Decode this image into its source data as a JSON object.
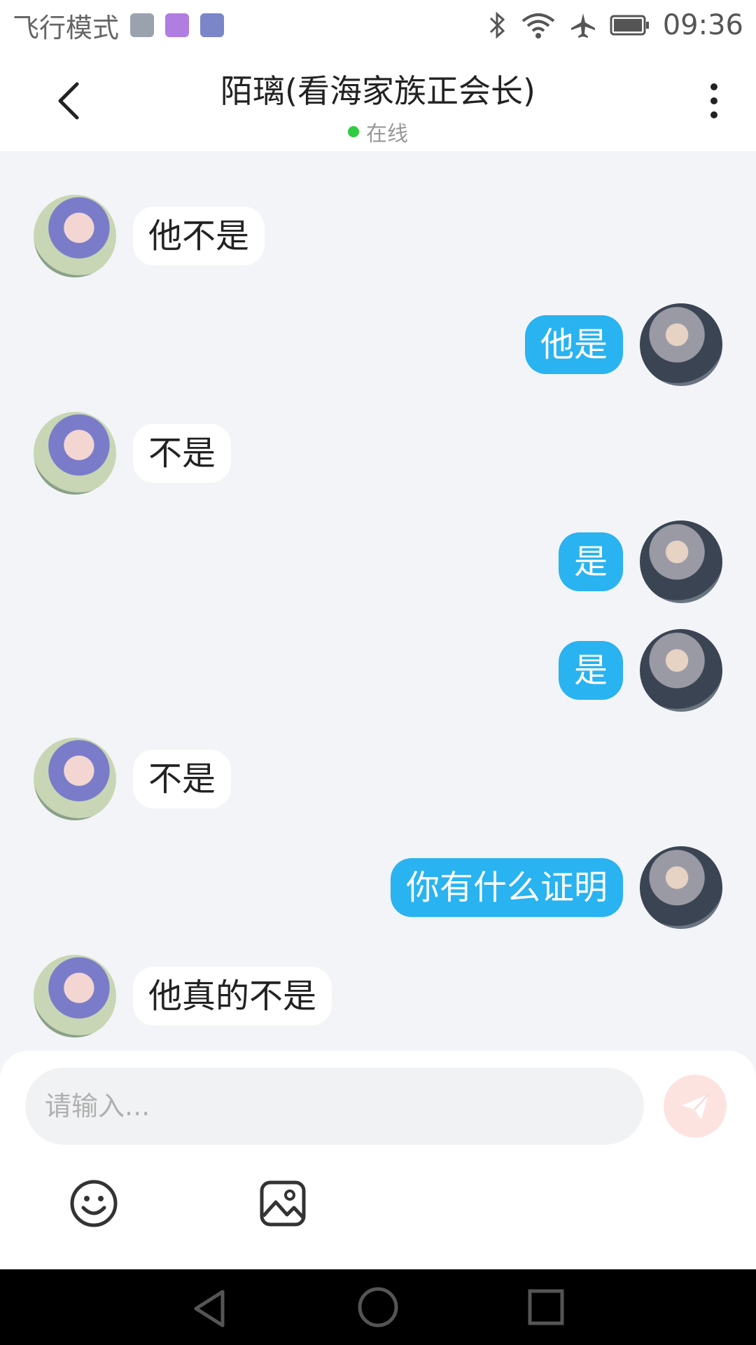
{
  "status_bar": {
    "mode_text": "飞行模式",
    "time": "09:36"
  },
  "header": {
    "title": "陌璃(看海家族正会长)",
    "status": "在线"
  },
  "messages": [
    {
      "side": "left",
      "text": "他不是"
    },
    {
      "side": "right",
      "text": "他是"
    },
    {
      "side": "left",
      "text": "不是"
    },
    {
      "side": "right",
      "text": "是"
    },
    {
      "side": "right",
      "text": "是"
    },
    {
      "side": "left",
      "text": "不是"
    },
    {
      "side": "right",
      "text": "你有什么证明"
    },
    {
      "side": "left",
      "text": "他真的不是"
    }
  ],
  "input": {
    "placeholder": "请输入..."
  },
  "colors": {
    "self_bubble": "#29b3f0",
    "other_bubble": "#ffffff",
    "online": "#2ecc40",
    "send_button": "#fde3e0"
  }
}
